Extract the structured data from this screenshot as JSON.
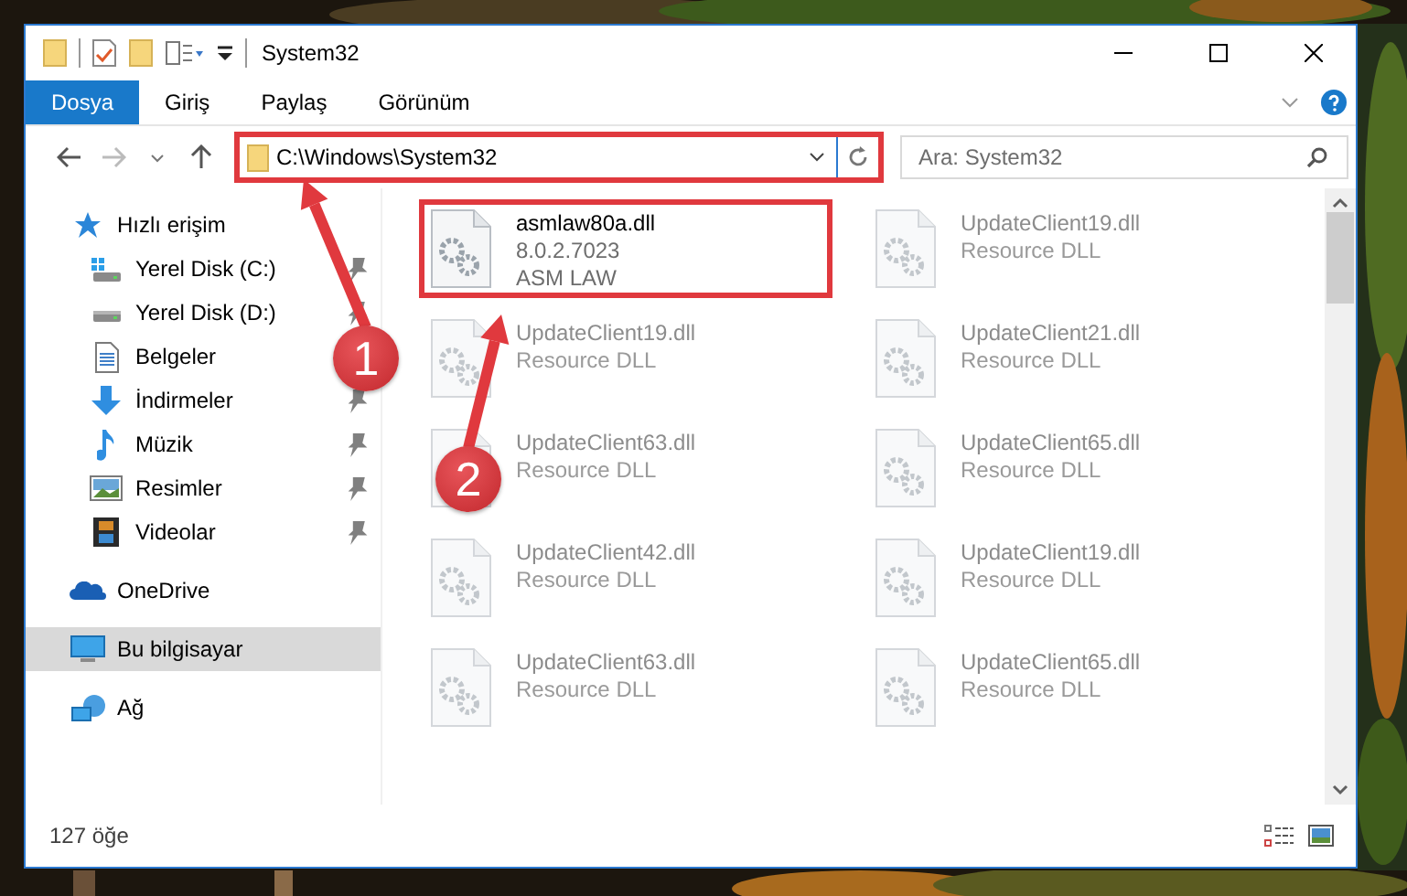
{
  "window": {
    "title": "System32"
  },
  "ribbon_tabs": [
    {
      "label": "Dosya",
      "selected": true
    },
    {
      "label": "Giriş",
      "selected": false
    },
    {
      "label": "Paylaş",
      "selected": false
    },
    {
      "label": "Görünüm",
      "selected": false
    }
  ],
  "address": {
    "value": "C:\\Windows\\System32",
    "highlighted": true
  },
  "search": {
    "placeholder": "Ara: System32"
  },
  "sidebar": {
    "items": [
      {
        "label": "Hızlı erişim",
        "kind": "star",
        "selected": false,
        "children": [
          {
            "label": "Yerel Disk (C:)",
            "kind": "drive-c",
            "pinned": true,
            "selected": false
          },
          {
            "label": "Yerel Disk (D:)",
            "kind": "drive",
            "pinned": true,
            "selected": false
          },
          {
            "label": "Belgeler",
            "kind": "document",
            "pinned": false,
            "selected": false
          },
          {
            "label": "İndirmeler",
            "kind": "download",
            "pinned": true,
            "selected": false
          },
          {
            "label": "Müzik",
            "kind": "music",
            "pinned": true,
            "selected": false
          },
          {
            "label": "Resimler",
            "kind": "pictures",
            "pinned": true,
            "selected": false
          },
          {
            "label": "Videolar",
            "kind": "video",
            "pinned": true,
            "selected": false
          }
        ]
      },
      {
        "label": "OneDrive",
        "kind": "cloud",
        "selected": false
      },
      {
        "label": "Bu bilgisayar",
        "kind": "pc",
        "selected": true
      },
      {
        "label": "Ağ",
        "kind": "network",
        "selected": false
      }
    ]
  },
  "files": [
    {
      "name": "asmlaw80a.dll",
      "details": [
        "8.0.2.7023",
        "ASM LAW"
      ],
      "highlighted": true,
      "dimmed": false
    },
    {
      "name": "UpdateClient19.dll",
      "details": [
        "Resource DLL"
      ],
      "highlighted": false,
      "dimmed": true
    },
    {
      "name": "UpdateClient19.dll",
      "details": [
        "Resource DLL"
      ],
      "highlighted": false,
      "dimmed": true
    },
    {
      "name": "UpdateClient21.dll",
      "details": [
        "Resource DLL"
      ],
      "highlighted": false,
      "dimmed": true
    },
    {
      "name": "UpdateClient63.dll",
      "details": [
        "Resource DLL"
      ],
      "highlighted": false,
      "dimmed": true
    },
    {
      "name": "UpdateClient65.dll",
      "details": [
        "Resource DLL"
      ],
      "highlighted": false,
      "dimmed": true
    },
    {
      "name": "UpdateClient42.dll",
      "details": [
        "Resource DLL"
      ],
      "highlighted": false,
      "dimmed": true
    },
    {
      "name": "UpdateClient19.dll",
      "details": [
        "Resource DLL"
      ],
      "highlighted": false,
      "dimmed": true
    },
    {
      "name": "UpdateClient63.dll",
      "details": [
        "Resource DLL"
      ],
      "highlighted": false,
      "dimmed": true
    },
    {
      "name": "UpdateClient65.dll",
      "details": [
        "Resource DLL"
      ],
      "highlighted": false,
      "dimmed": true
    }
  ],
  "callouts": [
    {
      "number": "1"
    },
    {
      "number": "2"
    }
  ],
  "status_bar": {
    "item_count": "127 öğe"
  }
}
